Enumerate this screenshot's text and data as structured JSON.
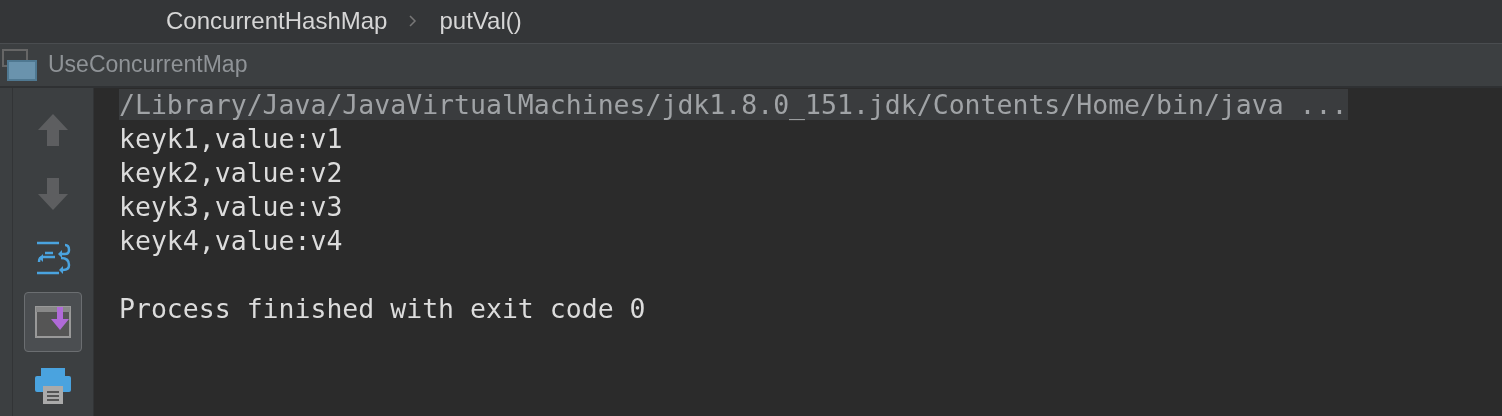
{
  "breadcrumbs": [
    {
      "label": "ConcurrentHashMap"
    },
    {
      "label": "putVal()"
    }
  ],
  "run_tab": {
    "title": "UseConcurrentMap"
  },
  "toolbar": [
    {
      "kind": "up",
      "disabled": true,
      "selected": false
    },
    {
      "kind": "down",
      "disabled": true,
      "selected": false
    },
    {
      "kind": "wrap",
      "disabled": false,
      "selected": false
    },
    {
      "kind": "scroll",
      "disabled": false,
      "selected": true
    },
    {
      "kind": "print",
      "disabled": false,
      "selected": false
    }
  ],
  "console": [
    {
      "kind": "command",
      "text": "/Library/Java/JavaVirtualMachines/jdk1.8.0_151.jdk/Contents/Home/bin/java ..."
    },
    {
      "kind": "output",
      "text": "keyk1,value:v1"
    },
    {
      "kind": "output",
      "text": "keyk2,value:v2"
    },
    {
      "kind": "output",
      "text": "keyk3,value:v3"
    },
    {
      "kind": "output",
      "text": "keyk4,value:v4"
    },
    {
      "kind": "blank"
    },
    {
      "kind": "output",
      "text": "Process finished with exit code 0"
    }
  ]
}
